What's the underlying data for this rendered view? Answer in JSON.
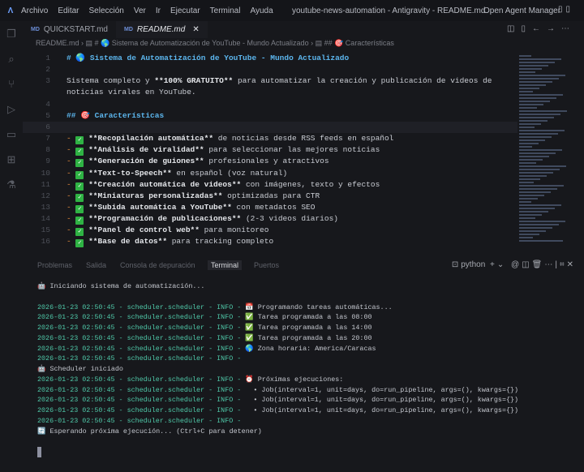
{
  "titlebar": {
    "menu": [
      "Archivo",
      "Editar",
      "Selección",
      "Ver",
      "Ir",
      "Ejecutar",
      "Terminal",
      "Ayuda"
    ],
    "title": "youtube-news-automation - Antigravity - README.md",
    "agent_manager": "Open Agent Manager"
  },
  "tabs": [
    {
      "label": "QUICKSTART.md",
      "icon": "MD"
    },
    {
      "label": "README.md",
      "icon": "MD",
      "close": "✕"
    }
  ],
  "breadcrumb": {
    "file": "README.md",
    "h1": "# 🌎 Sistema de Automatización de YouTube - Mundo Actualizado",
    "h2": "## 🎯 Características"
  },
  "editor": {
    "line_numbers": [
      "1",
      "2",
      "3",
      "",
      "4",
      "5",
      "6",
      "7",
      "8",
      "9",
      "10",
      "11",
      "12",
      "13",
      "14",
      "15",
      "16"
    ],
    "title": "# 🌎 Sistema de Automatización de YouTube - Mundo Actualizado",
    "p1a": "Sistema completo y ",
    "p1b": "**100% GRATUITO**",
    "p1c": " para automatizar la creación y publicación de videos de",
    "p2": "noticias virales en YouTube.",
    "h2": "## 🎯 Características",
    "features": [
      {
        "bold": "**Recopilación automática**",
        "rest": " de noticias desde RSS feeds en español"
      },
      {
        "bold": "**Análisis de viralidad**",
        "rest": " para seleccionar las mejores noticias"
      },
      {
        "bold": "**Generación de guiones**",
        "rest": " profesionales y atractivos"
      },
      {
        "bold": "**Text-to-Speech**",
        "rest": " en español (voz natural)"
      },
      {
        "bold": "**Creación automática de videos**",
        "rest": " con imágenes, texto y efectos"
      },
      {
        "bold": "**Miniaturas personalizadas**",
        "rest": " optimizadas para CTR"
      },
      {
        "bold": "**Subida automática a YouTube**",
        "rest": " con metadatos SEO"
      },
      {
        "bold": "**Programación de publicaciones**",
        "rest": " (2-3 videos diarios)"
      },
      {
        "bold": "**Panel de control web**",
        "rest": " para monitoreo"
      },
      {
        "bold": "**Base de datos**",
        "rest": " para tracking completo"
      }
    ]
  },
  "panel": {
    "tabs": [
      "Problemas",
      "Salida",
      "Consola de depuración",
      "Terminal",
      "Puertos"
    ],
    "shell": "python"
  },
  "terminal": {
    "prefix": "2026-01-23 02:50:45 - scheduler.scheduler - INFO - ",
    "lines": [
      {
        "plain": "🤖 Iniciando sistema de automatización..."
      },
      {
        "plain": " "
      },
      {
        "ts": true,
        "msg": "📅 Programando tareas automáticas..."
      },
      {
        "ts": true,
        "msg": "✅ Tarea programada a las 08:00"
      },
      {
        "ts": true,
        "msg": "✅ Tarea programada a las 14:00"
      },
      {
        "ts": true,
        "msg": "✅ Tarea programada a las 20:00"
      },
      {
        "ts": true,
        "msg": "🌎 Zona horaria: America/Caracas"
      },
      {
        "ts": true,
        "msg": ""
      },
      {
        "plain": "🤖 Scheduler iniciado"
      },
      {
        "ts": true,
        "msg": "⏰ Próximas ejecuciones:"
      },
      {
        "ts": true,
        "msg": "  • Job(interval=1, unit=days, do=run_pipeline, args=(), kwargs={})"
      },
      {
        "ts": true,
        "msg": "  • Job(interval=1, unit=days, do=run_pipeline, args=(), kwargs={})"
      },
      {
        "ts": true,
        "msg": "  • Job(interval=1, unit=days, do=run_pipeline, args=(), kwargs={})"
      },
      {
        "ts": true,
        "msg": ""
      },
      {
        "plain": "🔄 Esperando próxima ejecución... (Ctrl+C para detener)"
      }
    ]
  }
}
